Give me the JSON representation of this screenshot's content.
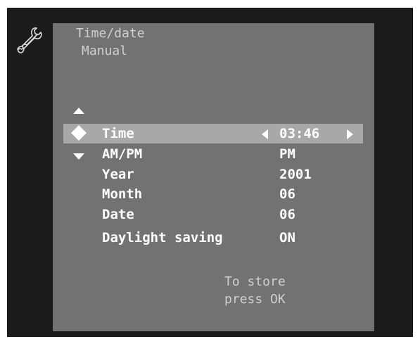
{
  "header": {
    "title": "Time/date",
    "subtitle": "Manual"
  },
  "icons": {
    "settings": "wrench-icon",
    "nav_up": "triangle-up-icon",
    "nav_down": "triangle-down-icon",
    "nav_selected": "four-way-diamond-icon",
    "value_decrease": "triangle-left-icon",
    "value_increase": "triangle-right-icon"
  },
  "menu": {
    "selected_index": 0,
    "items": [
      {
        "label": "Time",
        "value": "03:46"
      },
      {
        "label": "AM/PM",
        "value": "PM"
      },
      {
        "label": "Year",
        "value": "2001"
      },
      {
        "label": "Month",
        "value": "06"
      },
      {
        "label": "Date",
        "value": "06"
      },
      {
        "label": "Daylight saving",
        "value": "ON"
      }
    ]
  },
  "hint": {
    "line1": "To store",
    "line2": "press OK"
  },
  "colors": {
    "frame": "#1b1b1b",
    "panel": "#727272",
    "highlight": "#a8a8a8",
    "text": "#ffffff",
    "dim_text": "#cfcfcf"
  }
}
